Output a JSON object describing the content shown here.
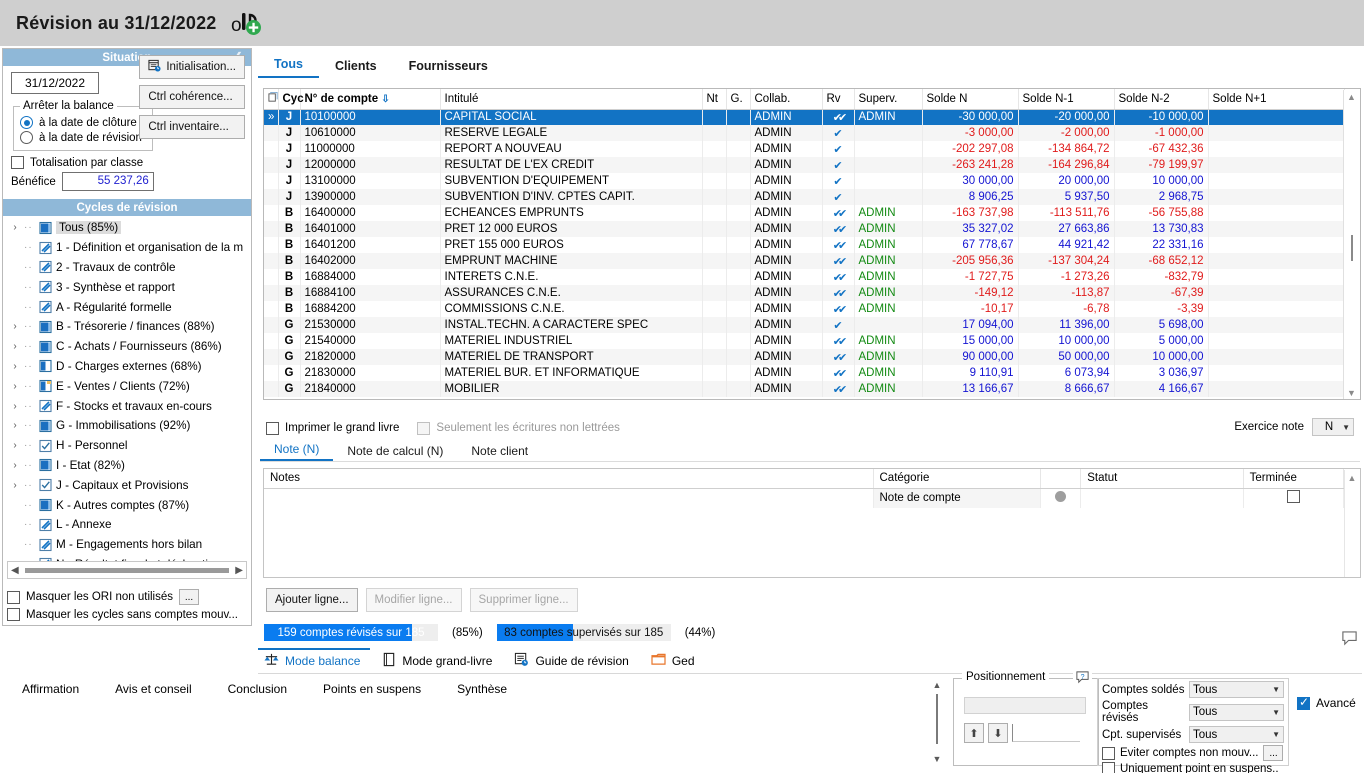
{
  "titlebar": {
    "title": "Révision au 31/12/2022",
    "icon": "add-account-icon"
  },
  "situation": {
    "header": "Situation",
    "collapse_icon": "chevron-left-icon",
    "date_value": "31/12/2022",
    "init_button": "Initialisation...",
    "init_icon": "calendar-clock-icon",
    "coherence_button": "Ctrl cohérence...",
    "inventaire_button": "Ctrl inventaire...",
    "fieldset_legend": "Arrêter la balance",
    "radio_cloture": "à la date de clôture",
    "radio_revision": "à la date de révision",
    "radio_selected": "cloture",
    "totalisation_label": "Totalisation par classe",
    "totalisation_checked": false,
    "benefice_label": "Bénéfice",
    "benefice_value": "55 237,26"
  },
  "cycles": {
    "header": "Cycles de révision",
    "items": [
      {
        "label": "Tous (85%)",
        "expandable": true,
        "state": "partial",
        "selected": true
      },
      {
        "label": "1 - Définition et organisation de la m",
        "expandable": false,
        "state": "hatched"
      },
      {
        "label": "2 - Travaux de contrôle",
        "expandable": false,
        "state": "hatched"
      },
      {
        "label": "3 - Synthèse et rapport",
        "expandable": false,
        "state": "hatched"
      },
      {
        "label": "A - Régularité formelle",
        "expandable": false,
        "state": "hatched"
      },
      {
        "label": "B - Trésorerie / finances (88%)",
        "expandable": true,
        "state": "partial"
      },
      {
        "label": "C - Achats / Fournisseurs (86%)",
        "expandable": true,
        "state": "partial"
      },
      {
        "label": "D - Charges externes (68%)",
        "expandable": true,
        "state": "half"
      },
      {
        "label": "E - Ventes / Clients (72%)",
        "expandable": true,
        "state": "flag"
      },
      {
        "label": "F - Stocks et travaux en-cours",
        "expandable": true,
        "state": "hatched"
      },
      {
        "label": "G - Immobilisations (92%)",
        "expandable": true,
        "state": "partial"
      },
      {
        "label": "H - Personnel",
        "expandable": true,
        "state": "check"
      },
      {
        "label": "I - Etat (82%)",
        "expandable": true,
        "state": "partial"
      },
      {
        "label": "J - Capitaux et Provisions",
        "expandable": true,
        "state": "check"
      },
      {
        "label": "K - Autres comptes (87%)",
        "expandable": false,
        "state": "partial"
      },
      {
        "label": "L - Annexe",
        "expandable": false,
        "state": "hatched"
      },
      {
        "label": "M - Engagements hors bilan",
        "expandable": false,
        "state": "hatched"
      },
      {
        "label": "N - Résultat fiscal et déclarations",
        "expandable": false,
        "state": "hatched"
      }
    ],
    "masquer_ori": "Masquer les ORI non utilisés",
    "masquer_ori_more": "...",
    "masquer_cycles": "Masquer les cycles sans comptes mouv..."
  },
  "tabs": {
    "items": [
      "Tous",
      "Clients",
      "Fournisseurs"
    ],
    "active": "Tous"
  },
  "grid": {
    "columns": [
      "",
      "Cyc",
      "N° de compte",
      "Intitulé",
      "Nt",
      "G.",
      "Collab.",
      "Rv",
      "Superv.",
      "Solde N",
      "Solde N-1",
      "Solde N-2",
      "Solde N+1"
    ],
    "sort_icon": "sort-az-icon",
    "rows": [
      {
        "mark": "»",
        "cyc": "J",
        "compte": "10100000",
        "intitule": "CAPITAL SOCIAL",
        "nt": "",
        "g": "",
        "collab": "ADMIN",
        "rv": "double",
        "superv": "ADMIN",
        "n": "-30 000,00",
        "n1": "-20 000,00",
        "n2": "-10 000,00",
        "np1": "",
        "selected": true
      },
      {
        "mark": "",
        "cyc": "J",
        "compte": "10610000",
        "intitule": "RESERVE LEGALE",
        "nt": "",
        "g": "",
        "collab": "ADMIN",
        "rv": "single",
        "superv": "",
        "n": "-3 000,00",
        "n1": "-2 000,00",
        "n2": "-1 000,00",
        "np1": ""
      },
      {
        "mark": "",
        "cyc": "J",
        "compte": "11000000",
        "intitule": "REPORT A NOUVEAU",
        "nt": "",
        "g": "",
        "collab": "ADMIN",
        "rv": "single",
        "superv": "",
        "n": "-202 297,08",
        "n1": "-134 864,72",
        "n2": "-67 432,36",
        "np1": ""
      },
      {
        "mark": "",
        "cyc": "J",
        "compte": "12000000",
        "intitule": "RESULTAT DE L'EX CREDIT",
        "nt": "",
        "g": "",
        "collab": "ADMIN",
        "rv": "single",
        "superv": "",
        "n": "-263 241,28",
        "n1": "-164 296,84",
        "n2": "-79 199,97",
        "np1": ""
      },
      {
        "mark": "",
        "cyc": "J",
        "compte": "13100000",
        "intitule": "SUBVENTION D'EQUIPEMENT",
        "nt": "",
        "g": "",
        "collab": "ADMIN",
        "rv": "single",
        "superv": "",
        "n": "30 000,00",
        "n1": "20 000,00",
        "n2": "10 000,00",
        "np1": ""
      },
      {
        "mark": "",
        "cyc": "J",
        "compte": "13900000",
        "intitule": "SUBVENTION D'INV. CPTES CAPIT.",
        "nt": "",
        "g": "",
        "collab": "ADMIN",
        "rv": "single",
        "superv": "",
        "n": "8 906,25",
        "n1": "5 937,50",
        "n2": "2 968,75",
        "np1": ""
      },
      {
        "mark": "",
        "cyc": "B",
        "compte": "16400000",
        "intitule": "ECHEANCES EMPRUNTS",
        "nt": "",
        "g": "",
        "collab": "ADMIN",
        "rv": "double",
        "superv": "ADMIN",
        "n": "-163 737,98",
        "n1": "-113 511,76",
        "n2": "-56 755,88",
        "np1": ""
      },
      {
        "mark": "",
        "cyc": "B",
        "compte": "16401000",
        "intitule": "PRET 12 000 EUROS",
        "nt": "",
        "g": "",
        "collab": "ADMIN",
        "rv": "double",
        "superv": "ADMIN",
        "n": "35 327,02",
        "n1": "27 663,86",
        "n2": "13 730,83",
        "np1": ""
      },
      {
        "mark": "",
        "cyc": "B",
        "compte": "16401200",
        "intitule": "PRET 155 000 EUROS",
        "nt": "",
        "g": "",
        "collab": "ADMIN",
        "rv": "double",
        "superv": "ADMIN",
        "n": "67 778,67",
        "n1": "44 921,42",
        "n2": "22 331,16",
        "np1": ""
      },
      {
        "mark": "",
        "cyc": "B",
        "compte": "16402000",
        "intitule": "EMPRUNT MACHINE",
        "nt": "",
        "g": "",
        "collab": "ADMIN",
        "rv": "double",
        "superv": "ADMIN",
        "n": "-205 956,36",
        "n1": "-137 304,24",
        "n2": "-68 652,12",
        "np1": ""
      },
      {
        "mark": "",
        "cyc": "B",
        "compte": "16884000",
        "intitule": "INTERETS C.N.E.",
        "nt": "",
        "g": "",
        "collab": "ADMIN",
        "rv": "double",
        "superv": "ADMIN",
        "n": "-1 727,75",
        "n1": "-1 273,26",
        "n2": "-832,79",
        "np1": ""
      },
      {
        "mark": "",
        "cyc": "B",
        "compte": "16884100",
        "intitule": "ASSURANCES C.N.E.",
        "nt": "",
        "g": "",
        "collab": "ADMIN",
        "rv": "double",
        "superv": "ADMIN",
        "n": "-149,12",
        "n1": "-113,87",
        "n2": "-67,39",
        "np1": ""
      },
      {
        "mark": "",
        "cyc": "B",
        "compte": "16884200",
        "intitule": "COMMISSIONS C.N.E.",
        "nt": "",
        "g": "",
        "collab": "ADMIN",
        "rv": "double",
        "superv": "ADMIN",
        "n": "-10,17",
        "n1": "-6,78",
        "n2": "-3,39",
        "np1": ""
      },
      {
        "mark": "",
        "cyc": "G",
        "compte": "21530000",
        "intitule": "INSTAL.TECHN. A CARACTERE SPEC",
        "nt": "",
        "g": "",
        "collab": "ADMIN",
        "rv": "single",
        "superv": "",
        "n": "17 094,00",
        "n1": "11 396,00",
        "n2": "5 698,00",
        "np1": ""
      },
      {
        "mark": "",
        "cyc": "G",
        "compte": "21540000",
        "intitule": "MATERIEL INDUSTRIEL",
        "nt": "",
        "g": "",
        "collab": "ADMIN",
        "rv": "double",
        "superv": "ADMIN",
        "n": "15 000,00",
        "n1": "10 000,00",
        "n2": "5 000,00",
        "np1": ""
      },
      {
        "mark": "",
        "cyc": "G",
        "compte": "21820000",
        "intitule": "MATERIEL DE TRANSPORT",
        "nt": "",
        "g": "",
        "collab": "ADMIN",
        "rv": "double",
        "superv": "ADMIN",
        "n": "90 000,00",
        "n1": "50 000,00",
        "n2": "10 000,00",
        "np1": ""
      },
      {
        "mark": "",
        "cyc": "G",
        "compte": "21830000",
        "intitule": "MATERIEL  BUR. ET INFORMATIQUE",
        "nt": "",
        "g": "",
        "collab": "ADMIN",
        "rv": "double",
        "superv": "ADMIN",
        "n": "9 110,91",
        "n1": "6 073,94",
        "n2": "3 036,97",
        "np1": ""
      },
      {
        "mark": "",
        "cyc": "G",
        "compte": "21840000",
        "intitule": "MOBILIER",
        "nt": "",
        "g": "",
        "collab": "ADMIN",
        "rv": "double",
        "superv": "ADMIN",
        "n": "13 166,67",
        "n1": "8 666,67",
        "n2": "4 166,67",
        "np1": ""
      }
    ]
  },
  "options": {
    "imprimer_grand_livre": "Imprimer le grand livre",
    "imprimer_checked": false,
    "seulement_non_lettrees": "Seulement les écritures non lettrées",
    "seulement_disabled": true,
    "exercice_note_label": "Exercice note",
    "exercice_note_value": "N"
  },
  "note_tabs": {
    "items": [
      "Note (N)",
      "Note de calcul (N)",
      "Note client"
    ],
    "active": "Note (N)"
  },
  "notes_table": {
    "columns": [
      "Notes",
      "Catégorie",
      "",
      "Statut",
      "Terminée"
    ],
    "rows": [
      {
        "notes": "",
        "categorie": "Note de compte",
        "dot": "grey-dot",
        "statut": "",
        "terminee": false
      }
    ]
  },
  "line_buttons": [
    {
      "label": "Ajouter ligne...",
      "disabled": false
    },
    {
      "label": "Modifier ligne...",
      "disabled": true
    },
    {
      "label": "Supprimer ligne...",
      "disabled": true
    }
  ],
  "progress": [
    {
      "label": "159 comptes révisés sur 185",
      "percent_label": "(85%)",
      "fill": 85,
      "color": "#0a7cf0"
    },
    {
      "label": "83 comptes supervisés sur 185",
      "percent_label": "(44%)",
      "fill": 44,
      "color": "#0a7cf0"
    }
  ],
  "modebar": [
    {
      "label": "Mode balance",
      "icon": "balance-scale-icon",
      "active": true
    },
    {
      "label": "Mode grand-livre",
      "icon": "book-icon",
      "active": false
    },
    {
      "label": "Guide de révision",
      "icon": "guide-clock-icon",
      "active": false
    },
    {
      "label": "Ged",
      "icon": "folder-icon",
      "active": false
    }
  ],
  "bottom_tabs": {
    "items": [
      "Affirmation",
      "Avis et conseil",
      "Conclusion",
      "Points en suspens",
      "Synthèse"
    ]
  },
  "positioning": {
    "legend": "Positionnement",
    "help_icon": "help-bubble-icon",
    "input_value": "",
    "up_icon": "arrow-up-icon",
    "down_icon": "arrow-down-icon"
  },
  "filters": {
    "rows": [
      {
        "label": "Comptes soldés",
        "value": "Tous"
      },
      {
        "label": "Comptes révisés",
        "value": "Tous"
      },
      {
        "label": "Cpt. supervisés",
        "value": "Tous"
      }
    ],
    "eviter_label": "Eviter comptes non mouv...",
    "eviter_more": "...",
    "eviter_checked": false,
    "uniquement_label": "Uniquement point en suspens..",
    "uniquement_checked": false,
    "avance_label": "Avancé",
    "avance_checked": true
  },
  "chat_icon": "chat-bubble-icon",
  "colors": {
    "accent": "#1273c4",
    "selection": "#1273c4",
    "negative": "#e01b1b",
    "positive": "#1414d2",
    "supervisor": "#128a12",
    "panel_header": "#8fb8d8",
    "titlebar": "#cfcfcf"
  }
}
